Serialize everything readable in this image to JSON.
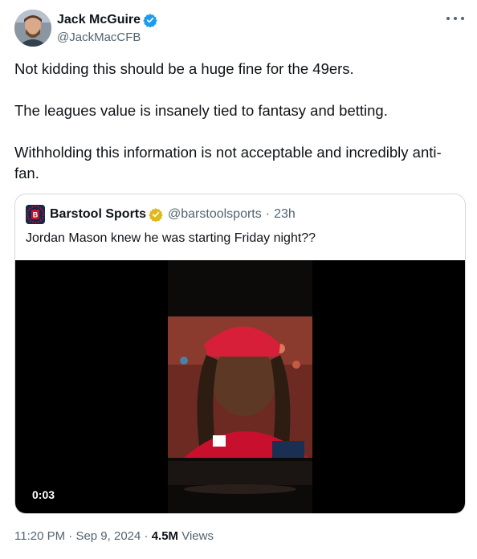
{
  "author": {
    "name": "Jack McGuire",
    "handle": "@JackMacCFB",
    "verified_color": "#1d9bf0"
  },
  "more_icon": "more-horizontal-icon",
  "tweet_text": [
    "Not kidding this should be a huge fine for the 49ers.",
    "The leagues value is insanely tied to fantasy and betting.",
    "Withholding this information is not acceptable and incredibly anti-fan."
  ],
  "quoted": {
    "name": "Barstool Sports",
    "handle": "@barstoolsports",
    "separator": "·",
    "time": "23h",
    "badge_color": "#e2b719",
    "text": "Jordan Mason knew he was starting Friday night??",
    "video": {
      "duration": "0:03"
    }
  },
  "meta": {
    "time": "11:20 PM",
    "dot": "·",
    "date": "Sep 9, 2024",
    "views_count": "4.5M",
    "views_label": "Views"
  }
}
